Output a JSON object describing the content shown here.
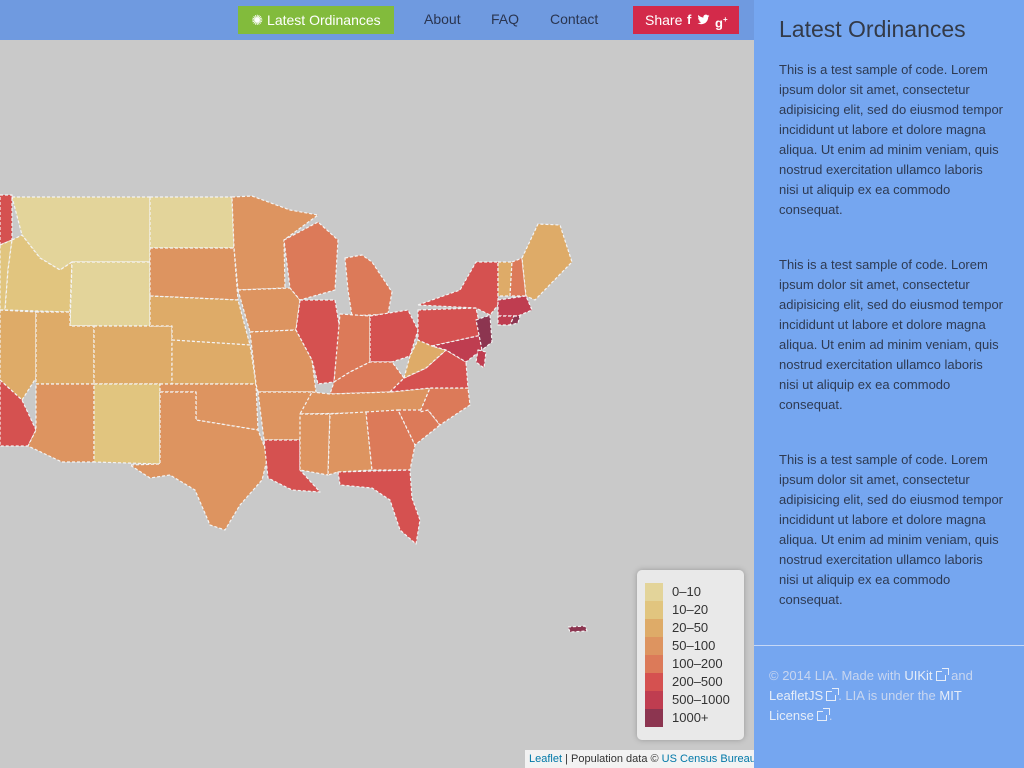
{
  "navbar": {
    "latest_label": "Latest Ordinances",
    "about": "About",
    "faq": "FAQ",
    "contact": "Contact",
    "share_label": "Share",
    "social_icons": [
      "facebook-icon",
      "twitter-icon",
      "google-plus-icon"
    ]
  },
  "sidebar": {
    "title": "Latest Ordinances",
    "paragraphs": [
      "This is a test sample of code. Lorem ipsum dolor sit amet, consectetur adipisicing elit, sed do eiusmod tempor incididunt ut labore et dolore magna aliqua. Ut enim ad minim veniam, quis nostrud exercitation ullamco laboris nisi ut aliquip ex ea commodo consequat.",
      "This is a test sample of code. Lorem ipsum dolor sit amet, consectetur adipisicing elit, sed do eiusmod tempor incididunt ut labore et dolore magna aliqua. Ut enim ad minim veniam, quis nostrud exercitation ullamco laboris nisi ut aliquip ex ea commodo consequat.",
      "This is a test sample of code. Lorem ipsum dolor sit amet, consectetur adipisicing elit, sed do eiusmod tempor incididunt ut labore et dolore magna aliqua. Ut enim ad minim veniam, quis nostrud exercitation ullamco laboris nisi ut aliquip ex ea commodo consequat."
    ]
  },
  "footer": {
    "prefix": "© 2014 LIA. Made with ",
    "uikit": "UIKit",
    "and": " and ",
    "leaflet": "LeafletJS",
    "mid": ". LIA is under the ",
    "license": "MIT License",
    "suffix": "."
  },
  "legend": {
    "items": [
      {
        "label": "0–10",
        "color": "#e3d49a"
      },
      {
        "label": "10–20",
        "color": "#e1c57f"
      },
      {
        "label": "20–50",
        "color": "#deab68"
      },
      {
        "label": "50–100",
        "color": "#dd9460"
      },
      {
        "label": "100–200",
        "color": "#dc7a59"
      },
      {
        "label": "200–500",
        "color": "#d55150"
      },
      {
        "label": "500–1000",
        "color": "#bf3d50"
      },
      {
        "label": "1000+",
        "color": "#8c3550"
      }
    ]
  },
  "attribution": {
    "leaflet": "Leaflet",
    "sep": " | Population data © ",
    "census": "US Census Bureau"
  },
  "colors": {
    "navbar": "#6f9ae0",
    "sidebar": "#75a6f0",
    "latest_button": "#82bb3c",
    "share_button": "#d32a4a",
    "map_background": "#c9c9c9"
  }
}
